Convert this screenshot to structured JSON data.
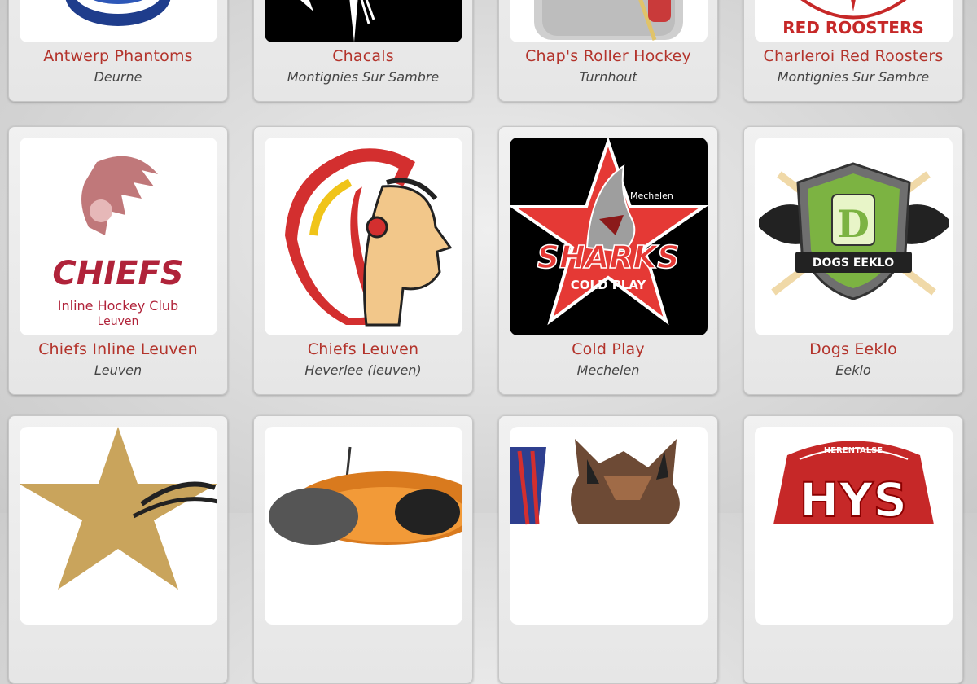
{
  "rows": [
    {
      "cards": [
        {
          "name": "Antwerp Phantoms",
          "city": "Deurne",
          "logo_icon": "antwerp-phantoms-logo"
        },
        {
          "name": "Chacals",
          "city": "Montignies Sur Sambre",
          "logo_icon": "chacals-logo"
        },
        {
          "name": "Chap's Roller Hockey",
          "city": "Turnhout",
          "logo_icon": "chaps-roller-hockey-logo"
        },
        {
          "name": "Charleroi Red Roosters",
          "city": "Montignies Sur Sambre",
          "logo_icon": "charleroi-red-roosters-logo",
          "logo_text": "RED ROOSTERS"
        }
      ]
    },
    {
      "cards": [
        {
          "name": "Chiefs Inline Leuven",
          "city": "Leuven",
          "logo_icon": "chiefs-inline-leuven-logo",
          "logo_text": "CHIEFS",
          "logo_subtext_1": "Inline Hockey Club",
          "logo_subtext_2": "Leuven"
        },
        {
          "name": "Chiefs Leuven",
          "city": "Heverlee (leuven)",
          "logo_icon": "chiefs-leuven-logo"
        },
        {
          "name": "Cold Play",
          "city": "Mechelen",
          "logo_icon": "cold-play-sharks-logo",
          "logo_text": "SHARKS",
          "logo_subtext_1": "COLD PLAY",
          "logo_subtext_2": "Mechelen"
        },
        {
          "name": "Dogs Eeklo",
          "city": "Eeklo",
          "logo_icon": "dogs-eeklo-logo",
          "logo_text": "DOGS EEKLO",
          "logo_letter": "D"
        }
      ]
    },
    {
      "cards": [
        {
          "name": "",
          "city": "",
          "logo_icon": "star-team-logo"
        },
        {
          "name": "",
          "city": "",
          "logo_icon": "orange-team-logo"
        },
        {
          "name": "",
          "city": "",
          "logo_icon": "coyote-team-logo"
        },
        {
          "name": "",
          "city": "",
          "logo_icon": "herentalse-hys-logo",
          "logo_text": "HYS",
          "logo_subtext_1": "HERENTALSE"
        }
      ]
    }
  ],
  "colors": {
    "name": "#b3332b",
    "city": "#444444",
    "card_bg": "#e9e9e9",
    "page_bg": "#dcdcdc"
  }
}
